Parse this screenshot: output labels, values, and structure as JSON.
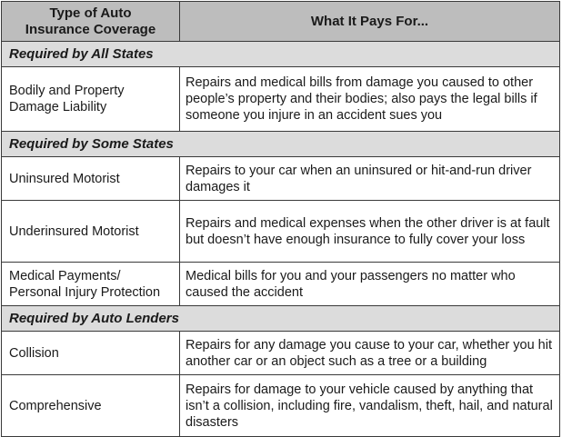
{
  "header": {
    "col1": "Type of Auto\nInsurance Coverage",
    "col2": "What It Pays For..."
  },
  "sections": [
    {
      "title": "Required by All States",
      "rows": [
        {
          "coverage": "Bodily and Property Damage Liability",
          "pays_for": "Repairs and medical bills from damage you caused to other people’s property and their bodies; also pays the legal bills if someone you injure in an accident sues you"
        }
      ]
    },
    {
      "title": "Required by Some States",
      "rows": [
        {
          "coverage": "Uninsured Motorist",
          "pays_for": "Repairs to your car when an uninsured or hit-and-run driver damages it"
        },
        {
          "coverage": "Underinsured Motorist",
          "pays_for": "Repairs and medical expenses when the other driver is at fault but doesn’t have enough insurance to fully cover your loss"
        },
        {
          "coverage": "Medical Payments/ Personal Injury Protection",
          "pays_for": "Medical bills for you and your passengers no matter who caused the accident"
        }
      ]
    },
    {
      "title": "Required by Auto Lenders",
      "rows": [
        {
          "coverage": "Collision",
          "pays_for": "Repairs for any damage you cause to your car, whether you hit another car or an object such as a tree or a building"
        },
        {
          "coverage": "Comprehensive",
          "pays_for": "Repairs for damage to your vehicle caused by anything that isn’t a collision, including fire, vandalism, theft, hail, and natural disasters"
        }
      ]
    }
  ]
}
